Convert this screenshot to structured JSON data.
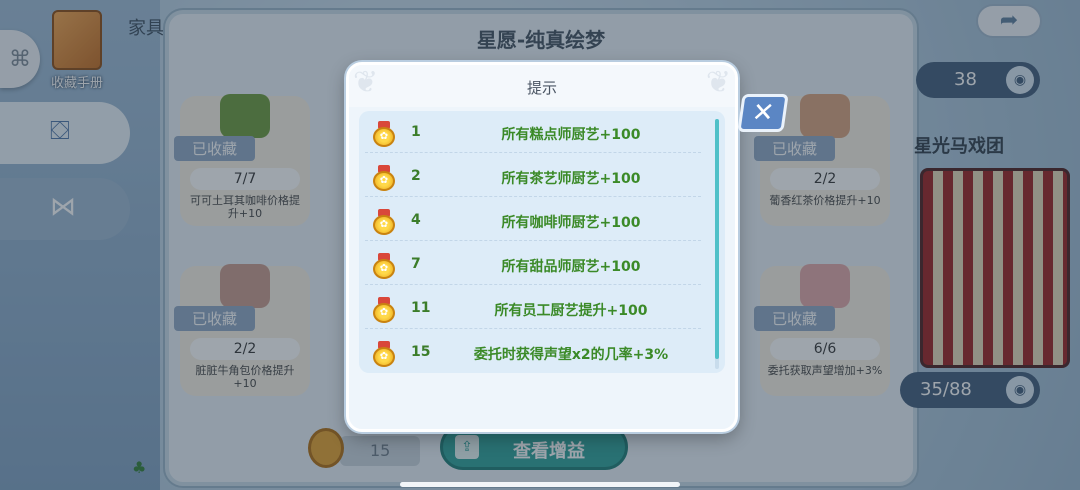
{
  "background": {
    "handbook_label": "收藏手册",
    "left_title": "家具",
    "panel_title": "星愿-纯真绘梦",
    "cards": [
      {
        "badge": "已收藏",
        "count": "7/7",
        "desc": "可可土耳其咖啡价格提升+10"
      },
      {
        "badge": "已收藏",
        "count": "2/2",
        "desc": "脏脏牛角包价格提升+10"
      },
      {
        "badge": "已收藏",
        "count": "2/2",
        "desc": "葡香红茶价格提升+10"
      },
      {
        "badge": "已收藏",
        "count": "6/6",
        "desc": "委托获取声望增加+3%"
      }
    ],
    "right_title": "星光马戏团",
    "right_top_count": "38",
    "right_bottom_count": "35/88",
    "bottom_medal_value": "15",
    "view_buff_label": "查看增益"
  },
  "modal": {
    "title": "提示",
    "rows": [
      {
        "level": "1",
        "text": "所有糕点师厨艺+100"
      },
      {
        "level": "2",
        "text": "所有茶艺师厨艺+100"
      },
      {
        "level": "4",
        "text": "所有咖啡师厨艺+100"
      },
      {
        "level": "7",
        "text": "所有甜品师厨艺+100"
      },
      {
        "level": "11",
        "text": "所有员工厨艺提升+100"
      },
      {
        "level": "15",
        "text": "委托时获得声望x2的几率+3%"
      }
    ],
    "close_icon": "close-x"
  },
  "colors": {
    "reward_text": "#3b8a28",
    "accent_teal": "#2aa198",
    "close_blue": "#5b86c4"
  }
}
